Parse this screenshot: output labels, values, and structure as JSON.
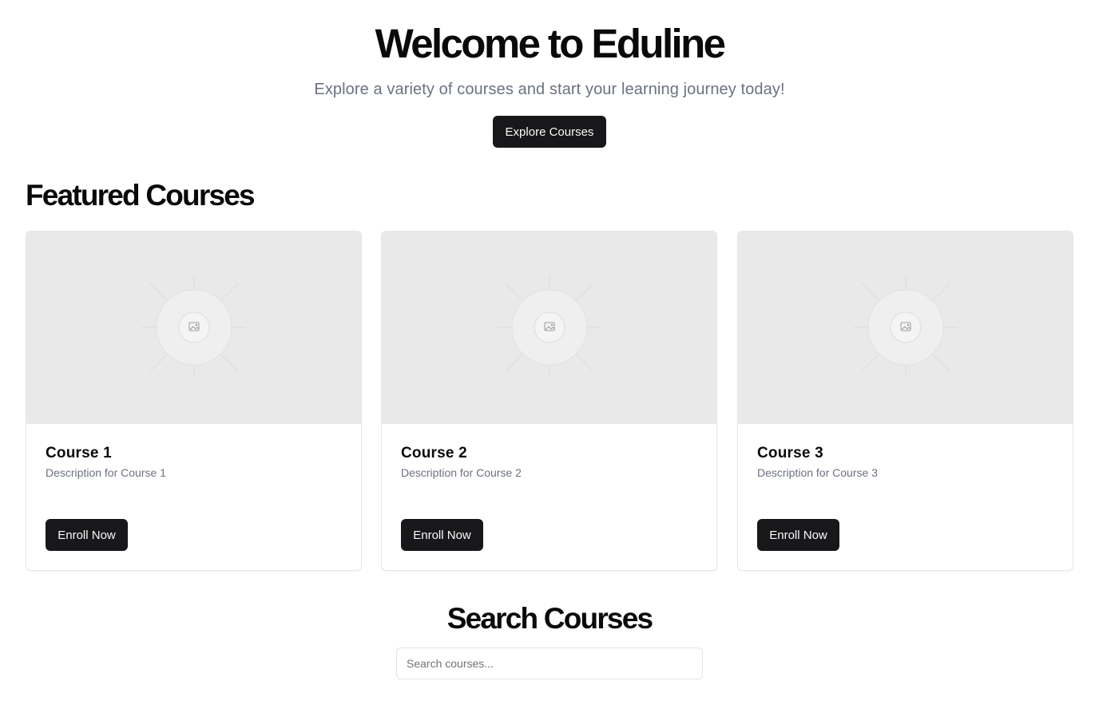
{
  "hero": {
    "title": "Welcome to Eduline",
    "subtitle": "Explore a variety of courses and start your learning journey today!",
    "cta_label": "Explore Courses"
  },
  "featured": {
    "heading": "Featured Courses",
    "courses": [
      {
        "title": "Course 1",
        "description": "Description for Course 1",
        "button_label": "Enroll Now",
        "image_icon": "image-placeholder-icon"
      },
      {
        "title": "Course 2",
        "description": "Description for Course 2",
        "button_label": "Enroll Now",
        "image_icon": "image-placeholder-icon"
      },
      {
        "title": "Course 3",
        "description": "Description for Course 3",
        "button_label": "Enroll Now",
        "image_icon": "image-placeholder-icon"
      }
    ]
  },
  "search": {
    "heading": "Search Courses",
    "placeholder": "Search courses...",
    "value": ""
  },
  "colors": {
    "primary_button": "#18181b",
    "button_text": "#fafafa",
    "muted_text": "#6b7280",
    "placeholder_bg": "#e9e9e9",
    "border": "#e5e7eb"
  }
}
